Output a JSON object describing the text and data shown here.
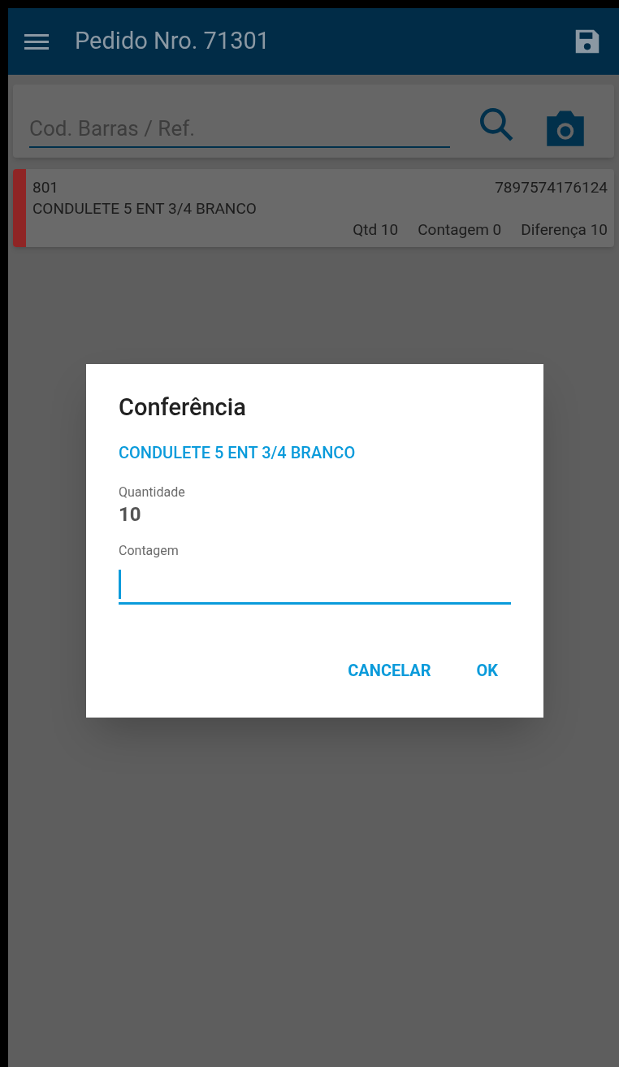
{
  "app_bar": {
    "title": "Pedido Nro. 71301"
  },
  "search": {
    "placeholder": "Cod. Barras / Ref."
  },
  "items": [
    {
      "code": "801",
      "barcode": "7897574176124",
      "description": "CONDULETE 5 ENT 3/4 BRANCO",
      "qty": "Qtd 10",
      "count": "Contagem 0",
      "difference": "Diferença 10",
      "color": "#8f2525"
    }
  ],
  "dialog": {
    "title": "Conferência",
    "product": "CONDULETE 5 ENT 3/4 BRANCO",
    "quantity_label": "Quantidade",
    "quantity": "10",
    "count_label": "Contagem",
    "buttons": [
      "CANCELAR",
      "OK"
    ]
  }
}
